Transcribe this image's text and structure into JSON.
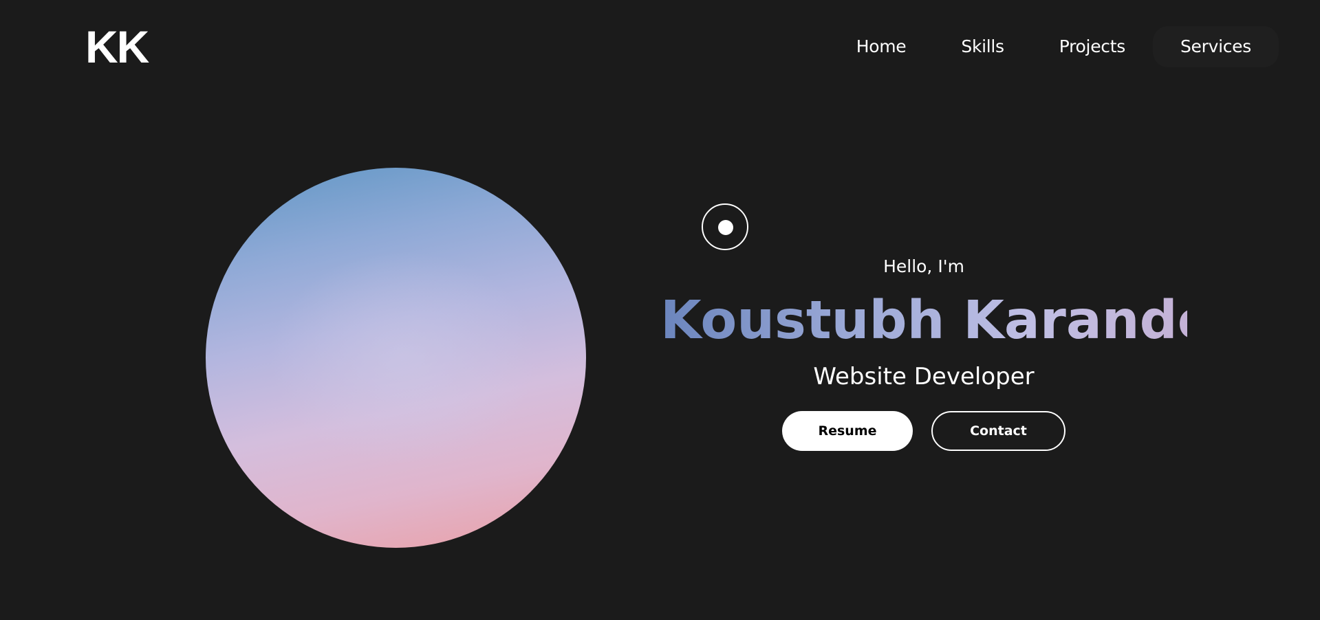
{
  "header": {
    "logo": "KK",
    "nav": [
      {
        "label": "Home"
      },
      {
        "label": "Skills"
      },
      {
        "label": "Projects"
      },
      {
        "label": "Services"
      }
    ]
  },
  "hero": {
    "greeting": "Hello, I'm",
    "name": "Koustubh Karande",
    "role": "Website Developer",
    "resume_label": "Resume",
    "contact_label": "Contact"
  },
  "colors": {
    "background": "#1b1b1b",
    "text": "#ffffff",
    "name_gradient_start": "#6b85bd",
    "name_gradient_end": "#c4b2d6",
    "orb_top": "#5f96c4",
    "orb_bottom": "#ea9fa5"
  },
  "icons": {
    "cursor": "custom-cursor-icon"
  }
}
